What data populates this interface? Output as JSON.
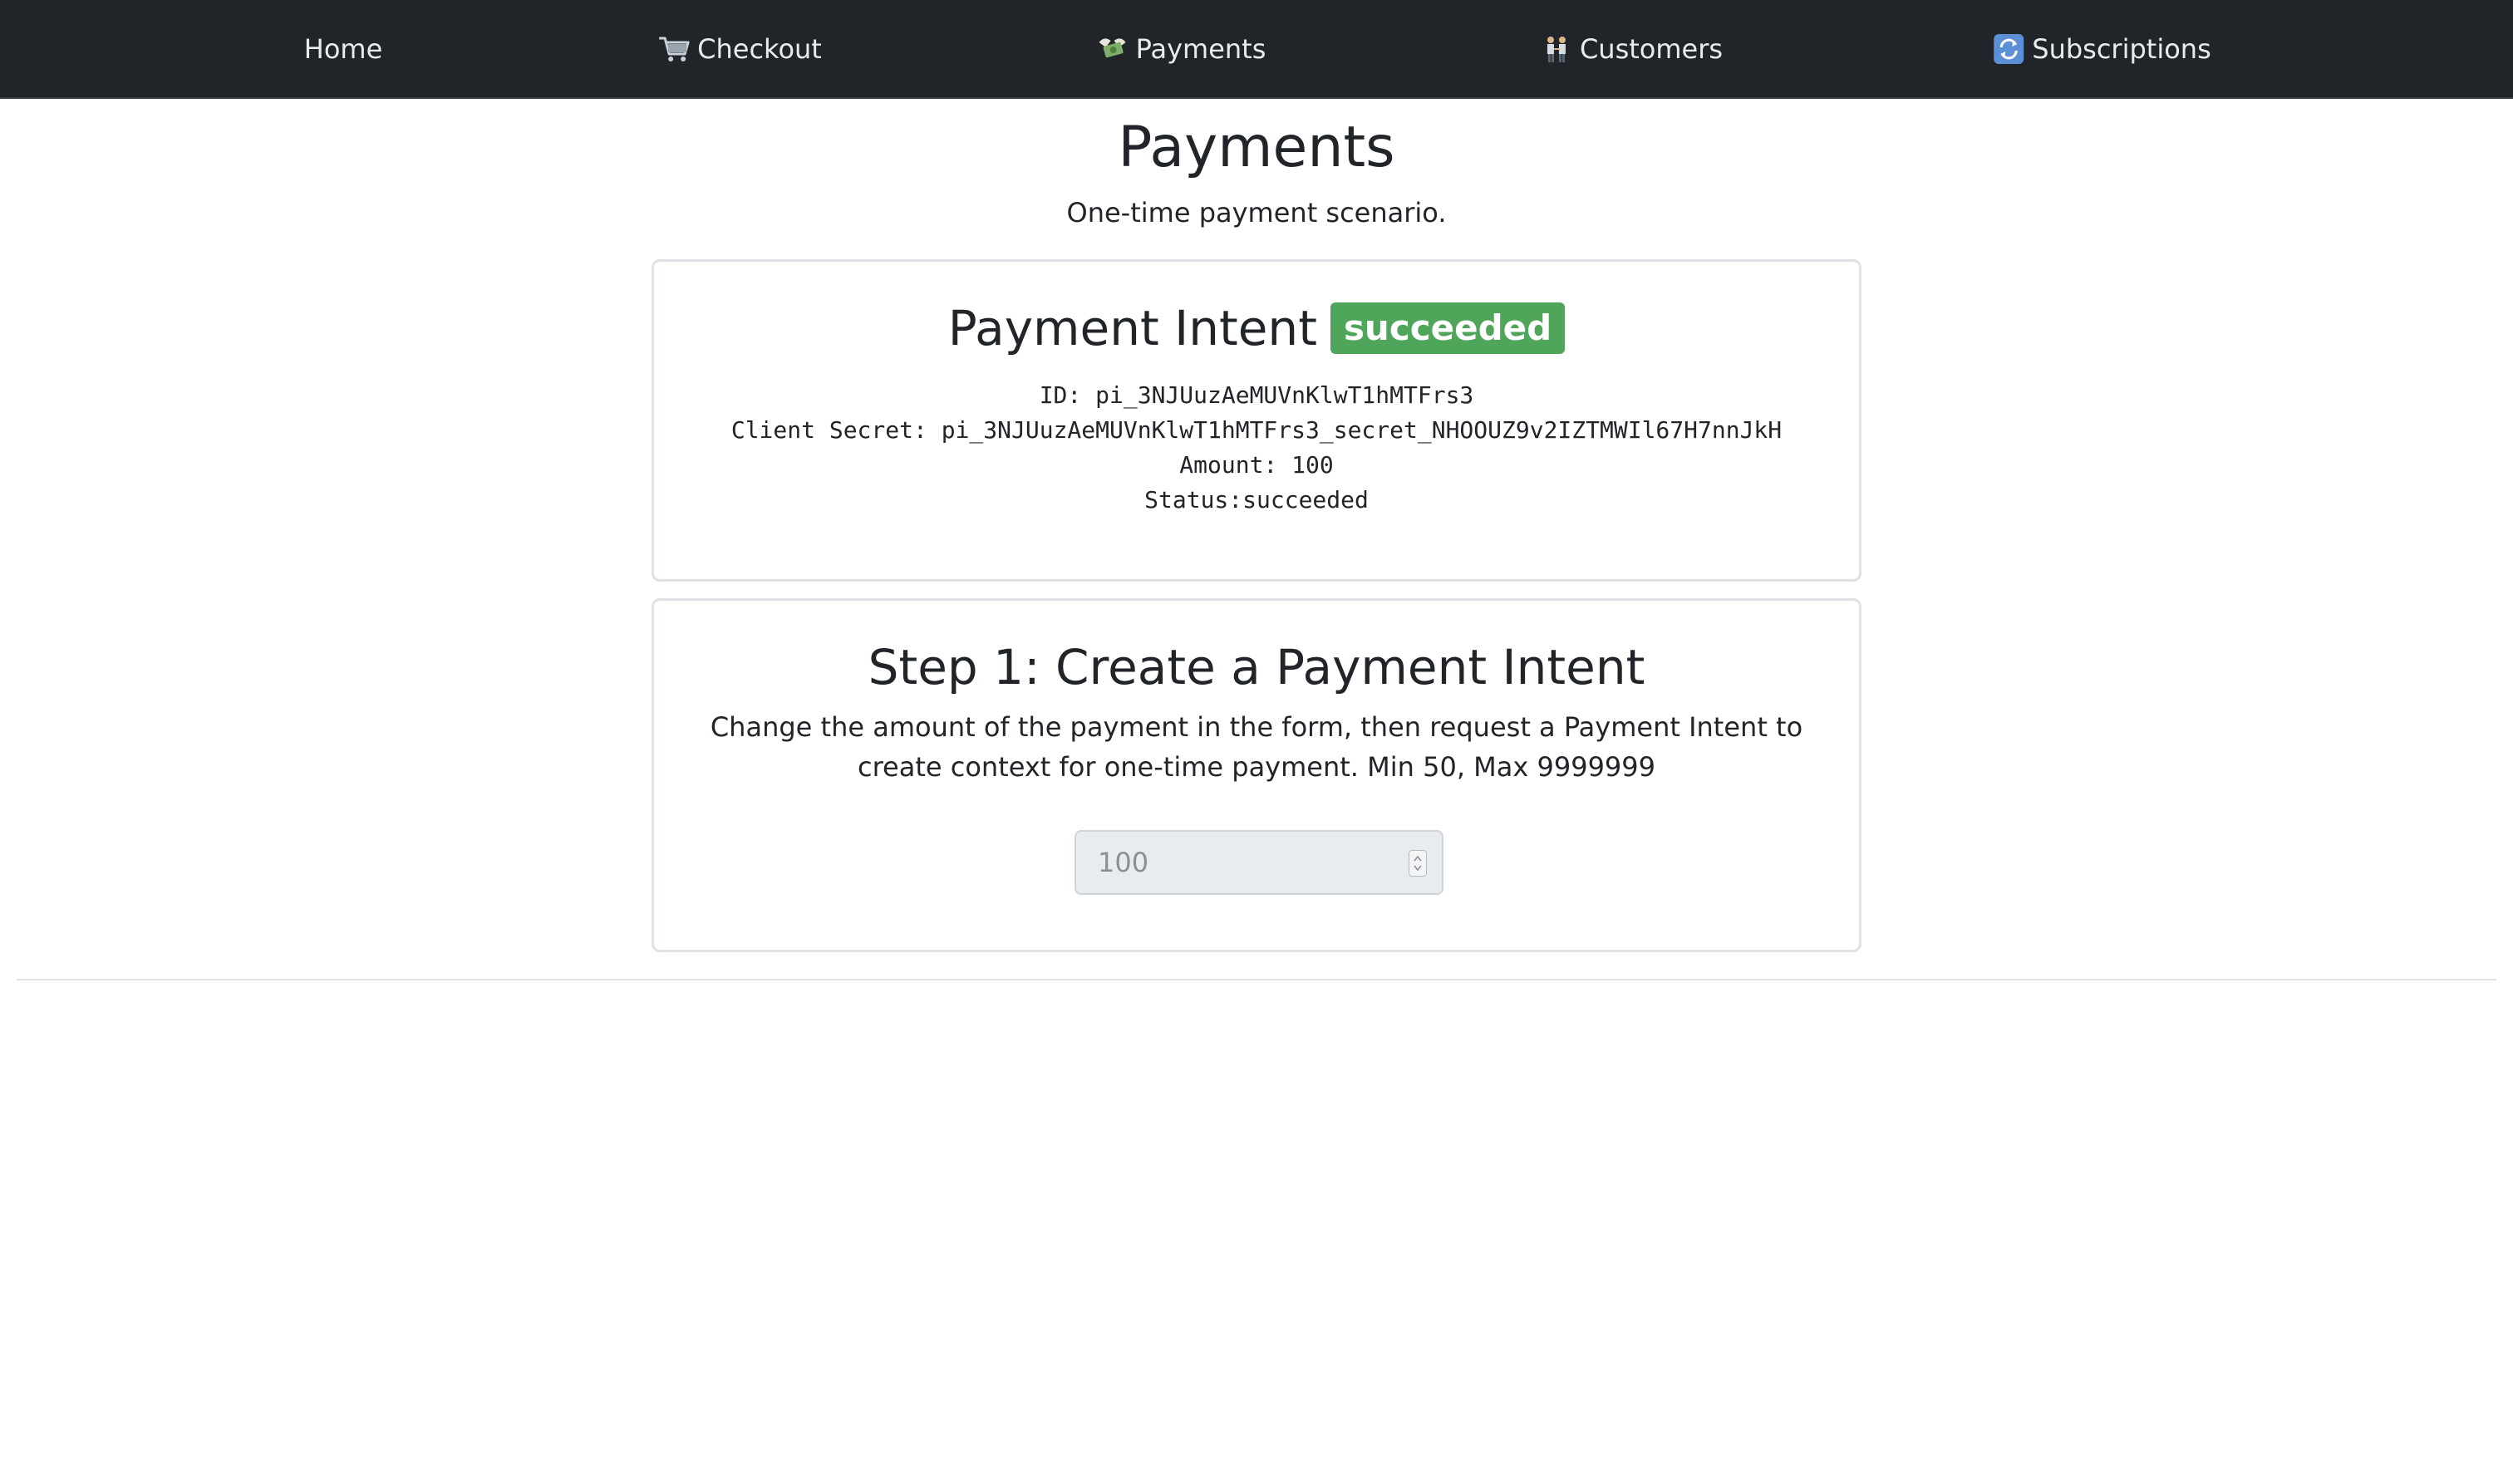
{
  "nav": {
    "items": [
      {
        "label": "Home",
        "icon": "none"
      },
      {
        "label": "Checkout",
        "icon": "shopping-cart-icon"
      },
      {
        "label": "Payments",
        "icon": "money-wings-icon"
      },
      {
        "label": "Customers",
        "icon": "people-holding-hands-icon"
      },
      {
        "label": "Subscriptions",
        "icon": "repeat-arrows-icon"
      }
    ]
  },
  "header": {
    "title": "Payments",
    "subtitle": "One-time payment scenario."
  },
  "intent": {
    "title": "Payment Intent",
    "badge": "succeeded",
    "id_line": "ID: pi_3NJUuzAeMUVnKlwT1hMTFrs3",
    "secret_line": "Client Secret: pi_3NJUuzAeMUVnKlwT1hMTFrs3_secret_NHOOUZ9v2IZTMWIl67H7nnJkH",
    "amount_line": "Amount: 100",
    "status_line": "Status:succeeded"
  },
  "step": {
    "title": "Step 1: Create a Payment Intent",
    "description": "Change the amount of the payment in the form, then request a Payment Intent to create context for one-time payment. Min 50, Max 9999999",
    "amount_value": "100"
  },
  "colors": {
    "navbar": "#212529",
    "badge": "#4fa55a",
    "input_bg": "#e9ecef"
  }
}
